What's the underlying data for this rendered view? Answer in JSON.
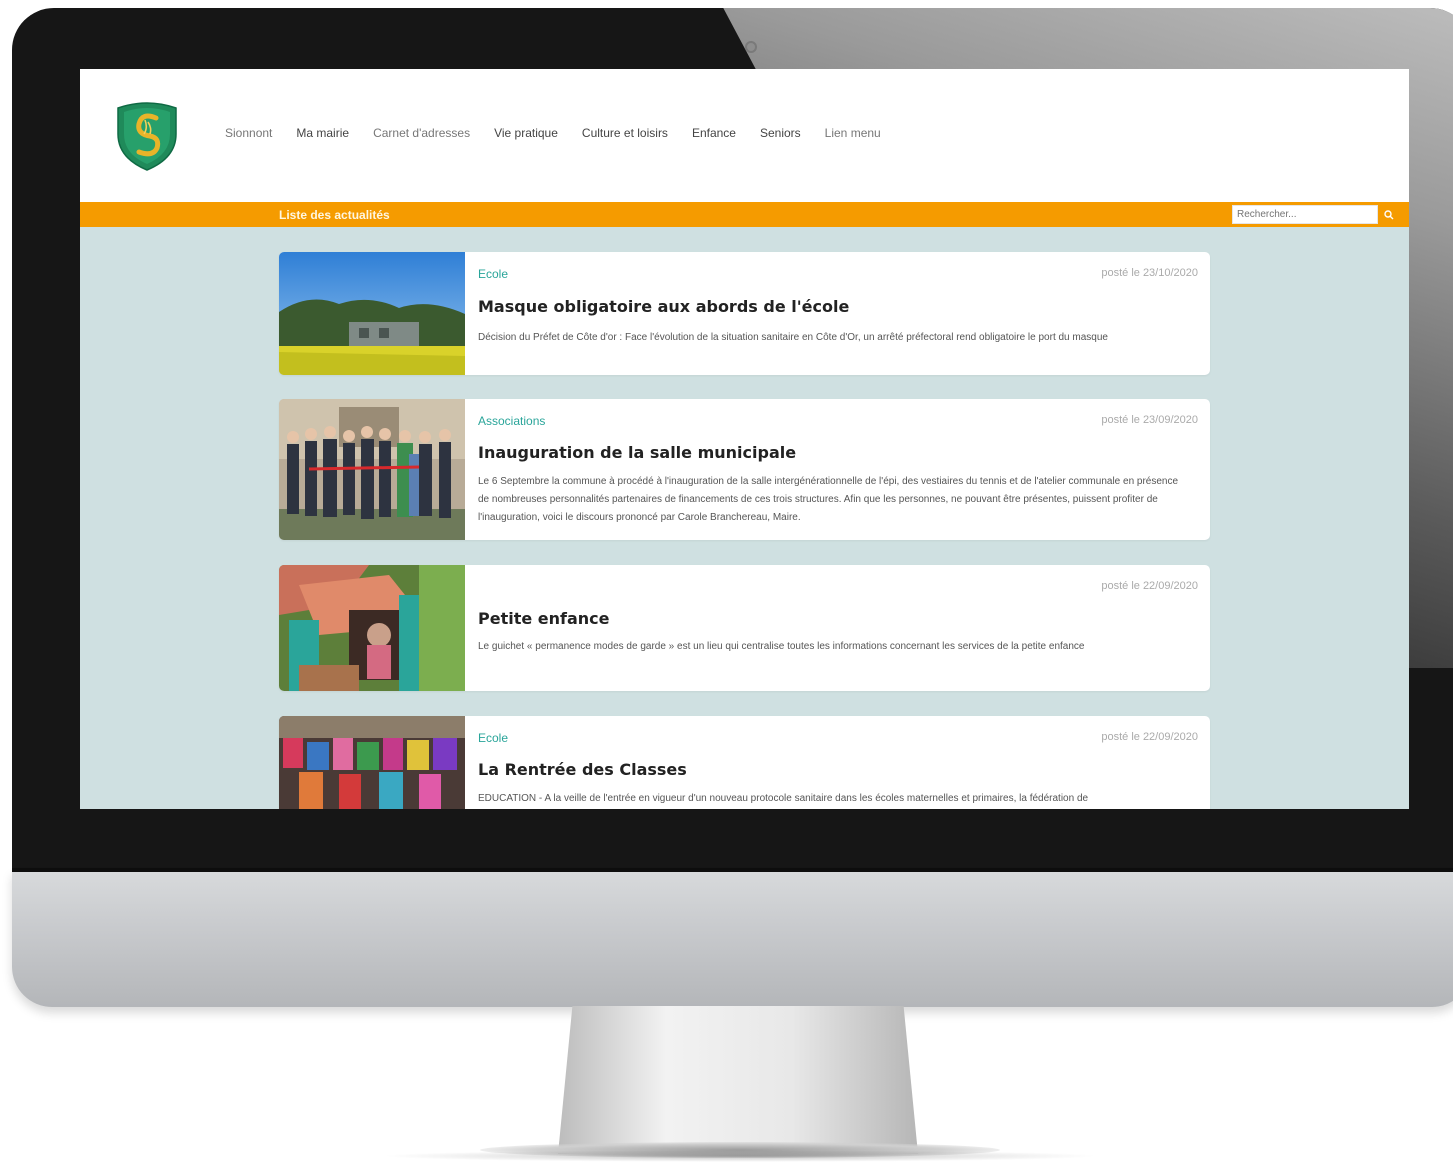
{
  "site": {
    "nav": [
      "Sionnont",
      "Ma mairie",
      "Carnet d'adresses",
      "Vie pratique",
      "Culture et loisirs",
      "Enfance",
      "Seniors",
      "Lien menu"
    ],
    "section_title": "Liste des actualités",
    "search_placeholder": "Rechercher..."
  },
  "articles": [
    {
      "category": "Ecole",
      "date": "posté le 23/10/2020",
      "title": "Masque obligatoire aux abords de l'école",
      "excerpt": "Décision du Préfet de Côte d'or : Face l'évolution de la situation sanitaire en Côte d'Or, un arrêté préfectoral rend obligatoire le port du masque"
    },
    {
      "category": "Associations",
      "date": "posté le 23/09/2020",
      "title": "Inauguration de la salle municipale",
      "excerpt": "Le 6 Septembre la commune à procédé à l'inauguration de la salle intergénérationnelle de l'épi, des vestiaires du tennis et de l'atelier communale en présence de nombreuses personnalités partenaires de financements de ces trois structures. Afin que les personnes, ne pouvant être présentes, puissent profiter de l'inauguration, voici le discours prononcé par Carole Branchereau, Maire."
    },
    {
      "category": "",
      "date": "posté le 22/09/2020",
      "title": "Petite enfance",
      "excerpt": "Le guichet « permanence modes de garde » est un lieu qui centralise toutes les informations concernant les services de la petite enfance"
    },
    {
      "category": "Ecole",
      "date": "posté le 22/09/2020",
      "title": "La Rentrée des Classes",
      "excerpt": "EDUCATION - A la veille de l'entrée en vigueur d'un nouveau protocole sanitaire dans les écoles maternelles et primaires, la fédération de"
    }
  ],
  "colors": {
    "accent_orange": "#f59b00",
    "category_teal": "#2aa59a",
    "page_background": "#cfe0e1",
    "logo_green": "#1f8a5a",
    "logo_gold": "#e8b429"
  },
  "icons": {
    "search": "search-icon",
    "logo": "shield-logo"
  }
}
